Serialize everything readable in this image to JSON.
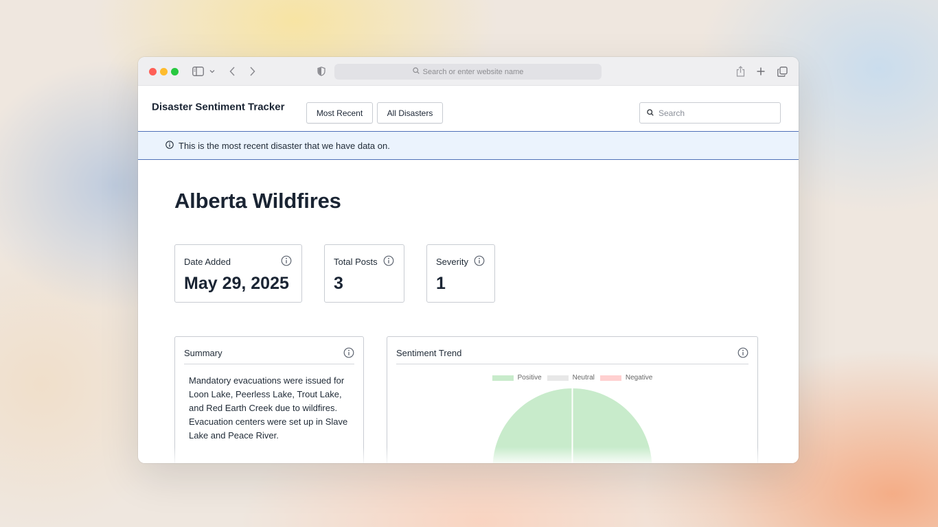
{
  "browser": {
    "address_placeholder": "Search or enter website name"
  },
  "header": {
    "app_title": "Disaster Sentiment Tracker",
    "nav": {
      "most_recent": "Most Recent",
      "all_disasters": "All Disasters"
    },
    "search_placeholder": "Search"
  },
  "banner": {
    "text": "This is the most recent disaster that we have data on."
  },
  "disaster": {
    "title": "Alberta Wildfires",
    "stats": {
      "date_added": {
        "label": "Date Added",
        "value": "May 29, 2025"
      },
      "total_posts": {
        "label": "Total Posts",
        "value": "3"
      },
      "severity": {
        "label": "Severity",
        "value": "1"
      }
    }
  },
  "summary": {
    "title": "Summary",
    "text": "Mandatory evacuations were issued for Loon Lake, Peerless Lake, Trout Lake, and Red Earth Creek due to wildfires. Evacuation centers were set up in Slave Lake and Peace River."
  },
  "sentiment": {
    "title": "Sentiment Trend"
  },
  "chart_data": {
    "type": "pie",
    "title": "",
    "legend_position": "top-center",
    "categories": [
      "Positive",
      "Neutral",
      "Negative"
    ],
    "values": [
      3,
      0,
      0
    ],
    "colors": [
      "#c8ebcb",
      "#e8e8e8",
      "#ffd0d0"
    ]
  }
}
